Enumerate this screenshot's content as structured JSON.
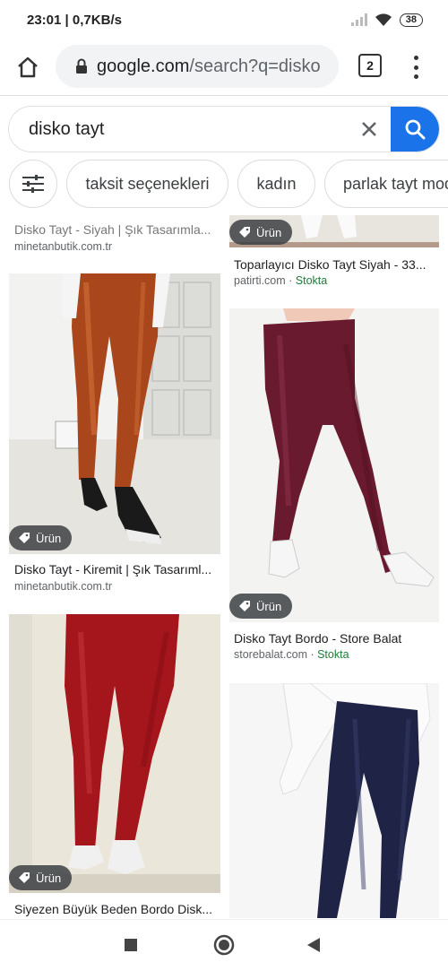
{
  "status_bar": {
    "time": "23:01",
    "speed": "0,7KB/s",
    "battery": "38"
  },
  "browser": {
    "url_domain": "google.com",
    "url_rest": "/search?q=disko",
    "tab_count": "2"
  },
  "search": {
    "query": "disko tayt"
  },
  "chips": [
    "taksit seçenekleri",
    "kadın",
    "parlak tayt modelleri"
  ],
  "results": {
    "left": [
      {
        "title": "Disko Tayt - Siyah | Şık Tasarımla...",
        "source": "minetanbutik.com.tr"
      },
      {
        "title": "Disko Tayt - Kiremit | Şık Tasarıml...",
        "source": "minetanbutik.com.tr",
        "badge": "Ürün"
      },
      {
        "title": "Siyezen Büyük Beden Bordo Disk...",
        "badge": "Ürün"
      }
    ],
    "right": [
      {
        "title": "Toparlayıcı Disko Tayt Siyah - 33...",
        "source": "patirti.com",
        "stock": "Stokta",
        "badge": "Ürün"
      },
      {
        "title": "Disko Tayt Bordo - Store Balat",
        "source": "storebalat.com",
        "stock": "Stokta",
        "badge": "Ürün"
      },
      {
        "title": ""
      }
    ]
  },
  "source_sep": " · "
}
